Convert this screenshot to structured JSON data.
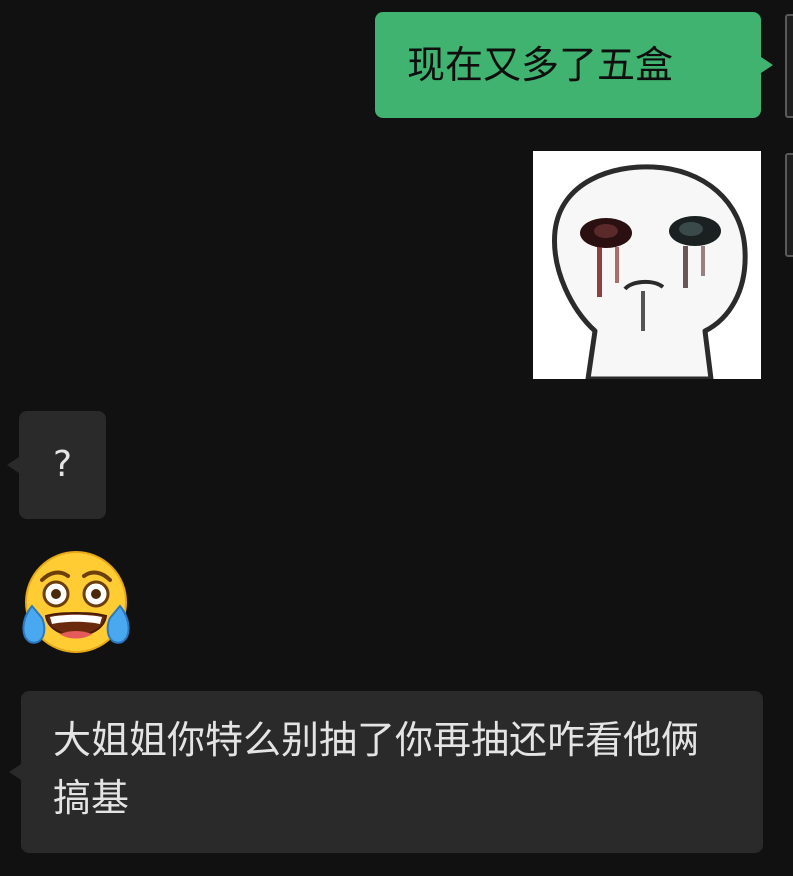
{
  "messages": [
    {
      "id": "msg1",
      "direction": "outgoing",
      "type": "text",
      "text": "现在又多了五盒"
    },
    {
      "id": "sticker",
      "direction": "outgoing",
      "type": "sticker",
      "sticker": "crying-cartoon-face-sticker"
    },
    {
      "id": "msg2",
      "direction": "incoming",
      "type": "text",
      "text": "?"
    },
    {
      "id": "emoji",
      "direction": "incoming",
      "type": "emoji",
      "emoji": "face-with-tears-of-joy-icon"
    },
    {
      "id": "msg3",
      "direction": "incoming",
      "type": "text",
      "text": "大姐姐你特么别抽了你再抽还咋看他俩搞基"
    }
  ],
  "colors": {
    "background": "#111111",
    "outgoing_bubble": "#3fb36f",
    "incoming_bubble": "#2a2a2a"
  }
}
